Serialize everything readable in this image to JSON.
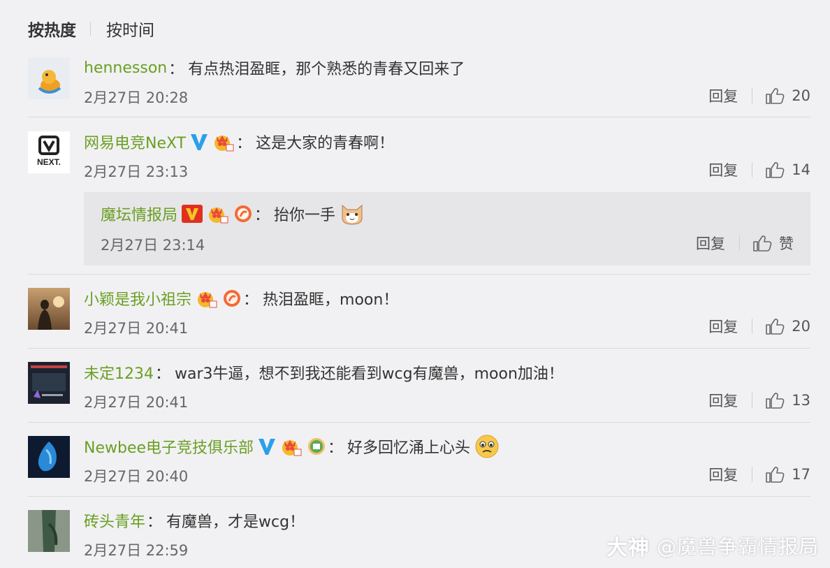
{
  "sort": {
    "hot": "按热度",
    "time": "按时间"
  },
  "actions": {
    "reply": "回复"
  },
  "comments": [
    {
      "user": "hennesson",
      "colon": "：",
      "text": "有点热泪盈眶，那个熟悉的青春又回来了",
      "time": "2月27日 20:28",
      "likes": "20"
    },
    {
      "user": "网易电竞NeXT",
      "colon": "：",
      "text": "这是大家的青春啊！",
      "time": "2月27日 23:13",
      "likes": "14",
      "avatar_text": "NEXT."
    },
    {
      "user": "小颖是我小祖宗",
      "colon": "：",
      "text": "热泪盈眶，moon！",
      "time": "2月27日 20:41",
      "likes": "20"
    },
    {
      "user": "未定1234",
      "colon": "：",
      "text": "war3牛逼，想不到我还能看到wcg有魔兽，moon加油！",
      "time": "2月27日 20:41",
      "likes": "13"
    },
    {
      "user": "Newbee电子竞技俱乐部",
      "colon": "：",
      "text": "好多回忆涌上心头",
      "time": "2月27日 20:40",
      "likes": "17"
    },
    {
      "user": "砖头青年",
      "colon": "：",
      "text": "有魔兽，才是wcg！",
      "time": "2月27日 22:59",
      "likes": ""
    }
  ],
  "reply": {
    "user": "魔坛情报局",
    "colon": "：",
    "text": "抬你一手",
    "time": "2月27日 23:14",
    "like_label": "赞"
  },
  "watermark": {
    "brand": "大神",
    "handle": "@魔兽争霸情报局"
  },
  "colors": {
    "username": "#6a9f23",
    "background": "#f1f1f3",
    "reply_bg": "#e6e6e8",
    "verified_blue": "#2aa0e8",
    "verified_red": "#e0301e"
  }
}
